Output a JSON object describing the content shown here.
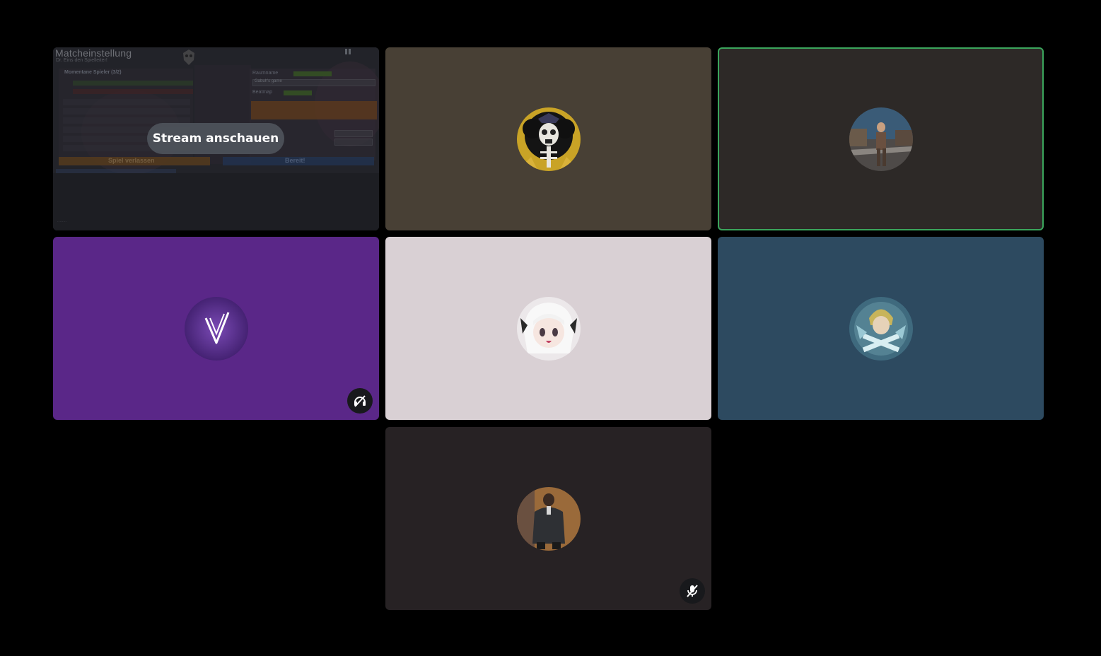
{
  "stream_tile": {
    "watch_label": "Stream anschauen",
    "preview": {
      "title": "Matcheinstellung",
      "subtitle": "Dr. Eins den Spielleiter!",
      "players_heading": "Momentane Spieler (3/2)",
      "room_label": "Raumname",
      "room_value": "Gabuh's game",
      "beatmap_label": "Beatmap",
      "leave_button": "Spiel verlassen",
      "ready_button": "Bereit!"
    }
  },
  "participants": [
    {
      "id": "stream-preview",
      "tile_color": "#2b2d33",
      "speaking": false
    },
    {
      "id": "skeleton-pirate",
      "tile_color": "#484035",
      "avatar_icon": "skeleton-avatar-icon",
      "speaking": false
    },
    {
      "id": "street-runner",
      "tile_color": "#2d2927",
      "avatar_icon": "street-photo-avatar-icon",
      "speaking": true,
      "speaking_color": "#3ba55c"
    },
    {
      "id": "purple-v",
      "tile_color": "#5a2788",
      "avatar_icon": "v-logo-avatar-icon",
      "status_icon": "deafened-headphones-icon",
      "speaking": false
    },
    {
      "id": "white-hair-girl",
      "tile_color": "#d9d0d4",
      "avatar_icon": "anime-girl-avatar-icon",
      "speaking": false
    },
    {
      "id": "blonde-boy",
      "tile_color": "#2d4a60",
      "avatar_icon": "anime-boy-avatar-icon",
      "speaking": false
    },
    {
      "id": "dark-suit-man",
      "tile_color": "#272224",
      "avatar_icon": "man-in-suit-avatar-icon",
      "status_icon": "muted-microphone-icon",
      "speaking": false
    }
  ]
}
